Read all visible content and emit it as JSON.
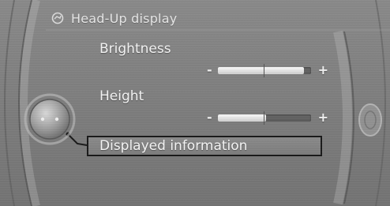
{
  "header": {
    "title": "Head-Up display",
    "icon": "head-up-display-icon"
  },
  "menu": {
    "items": [
      {
        "label": "Brightness",
        "type": "slider",
        "value": 0.92,
        "minus": "-",
        "plus": "+"
      },
      {
        "label": "Height",
        "type": "slider",
        "value": 0.52,
        "minus": "-",
        "plus": "+"
      }
    ],
    "selected": {
      "label": "Displayed information"
    }
  },
  "colors": {
    "background": "#7f7f7f",
    "text": "#f4f4f4",
    "title_text": "#e6e6e6",
    "selection_border": "#1a1a1a",
    "slider_fill": "#f0f0f0"
  }
}
